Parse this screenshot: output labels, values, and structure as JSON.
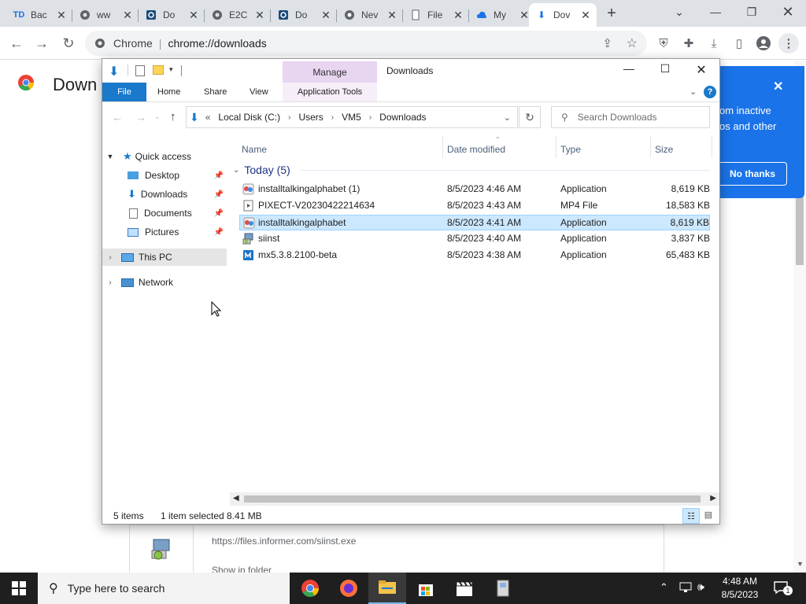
{
  "browser": {
    "tabs": [
      {
        "label": "Bac",
        "icon": "td-icon"
      },
      {
        "label": "ww",
        "icon": "globe-icon"
      },
      {
        "label": "Do",
        "icon": "square-app-icon"
      },
      {
        "label": "E2C",
        "icon": "globe-icon"
      },
      {
        "label": "Do",
        "icon": "square-app-icon"
      },
      {
        "label": "Nev",
        "icon": "chrome-icon"
      },
      {
        "label": "File",
        "icon": "file-icon"
      },
      {
        "label": "My",
        "icon": "cloud-icon"
      },
      {
        "label": "Dov",
        "icon": "download-icon"
      }
    ],
    "new_tab": "+",
    "address_site": "Chrome",
    "address_url": "chrome://downloads"
  },
  "page": {
    "heading": "Down",
    "download_url": "https://files.informer.com/siinst.exe",
    "show_in_folder": "Show in folder"
  },
  "popup": {
    "line1": "om inactive",
    "line2": "os and other",
    "no_thanks": "No thanks"
  },
  "explorer": {
    "title": "Downloads",
    "manage": "Manage",
    "ribbon_tabs": [
      "File",
      "Home",
      "Share",
      "View",
      "Application Tools"
    ],
    "breadcrumb": [
      "Local Disk (C:)",
      "Users",
      "VM5",
      "Downloads"
    ],
    "search_placeholder": "Search Downloads",
    "nav": {
      "quick_access": "Quick access",
      "desktop": "Desktop",
      "downloads": "Downloads",
      "documents": "Documents",
      "pictures": "Pictures",
      "this_pc": "This PC",
      "network": "Network"
    },
    "columns": {
      "name": "Name",
      "date": "Date modified",
      "type": "Type",
      "size": "Size"
    },
    "group_label": "Today (5)",
    "files": [
      {
        "name": "installtalkingalphabet (1)",
        "date": "8/5/2023 4:46 AM",
        "type": "Application",
        "size": "8,619 KB",
        "icon": "installer-icon"
      },
      {
        "name": "PIXECT-V20230422214634",
        "date": "8/5/2023 4:43 AM",
        "type": "MP4 File",
        "size": "18,583 KB",
        "icon": "video-file-icon"
      },
      {
        "name": "installtalkingalphabet",
        "date": "8/5/2023 4:41 AM",
        "type": "Application",
        "size": "8,619 KB",
        "icon": "installer-icon"
      },
      {
        "name": "siinst",
        "date": "8/5/2023 4:40 AM",
        "type": "Application",
        "size": "3,837 KB",
        "icon": "setup-icon"
      },
      {
        "name": "mx5.3.8.2100-beta",
        "date": "8/5/2023 4:38 AM",
        "type": "Application",
        "size": "65,483 KB",
        "icon": "app-blue-icon"
      }
    ],
    "status_items": "5 items",
    "status_selected": "1 item selected",
    "status_size": "8.41 MB"
  },
  "taskbar": {
    "search_placeholder": "Type here to search",
    "time": "4:48 AM",
    "date": "8/5/2023",
    "notifications_count": "1"
  },
  "colors": {
    "chrome_tabbar": "#dee1e6",
    "chrome_blue": "#1a73e8",
    "ribbon_file": "#1979ca",
    "manage_tab": "#e8d5f0",
    "selection": "#cce8ff",
    "taskbar": "#1f1f1f"
  }
}
